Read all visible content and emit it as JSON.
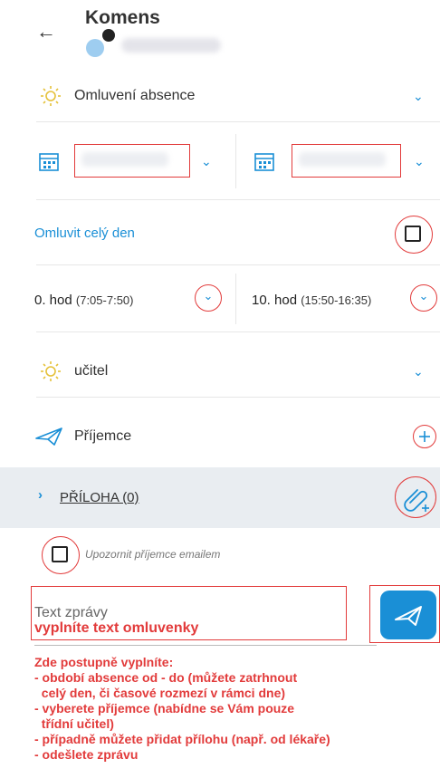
{
  "header": {
    "back_icon": "←",
    "title": "Komens"
  },
  "absence": {
    "label": "Omluvení absence"
  },
  "full_day": {
    "label": "Omluvit celý den"
  },
  "hours": {
    "from": {
      "bold": "0. hod",
      "range": "(7:05-7:50)"
    },
    "to": {
      "bold": "10. hod",
      "range": "(15:50-16:35)"
    }
  },
  "recipient_type": {
    "label": "učitel"
  },
  "recipients": {
    "label": "Příjemce"
  },
  "attachment": {
    "label": "PŘÍLOHA (0)"
  },
  "notify": {
    "label": "Upozornit příjemce emailem"
  },
  "message": {
    "placeholder": "Text zprávy",
    "hint": "vyplníte text omluvenky"
  },
  "instructions": [
    "Zde postupně vyplníte:",
    "- období absence od - do (můžete zatrhnout",
    "  celý den, či časové rozmezí v rámci dne)",
    "- vyberete příjemce (nabídne se Vám pouze",
    "  třídní učitel)",
    "- případně můžete přidat přílohu (např. od lékaře)",
    "- odešlete zprávu"
  ],
  "colors": {
    "accent": "#1a8fd6",
    "annotation": "#e23b3b"
  }
}
